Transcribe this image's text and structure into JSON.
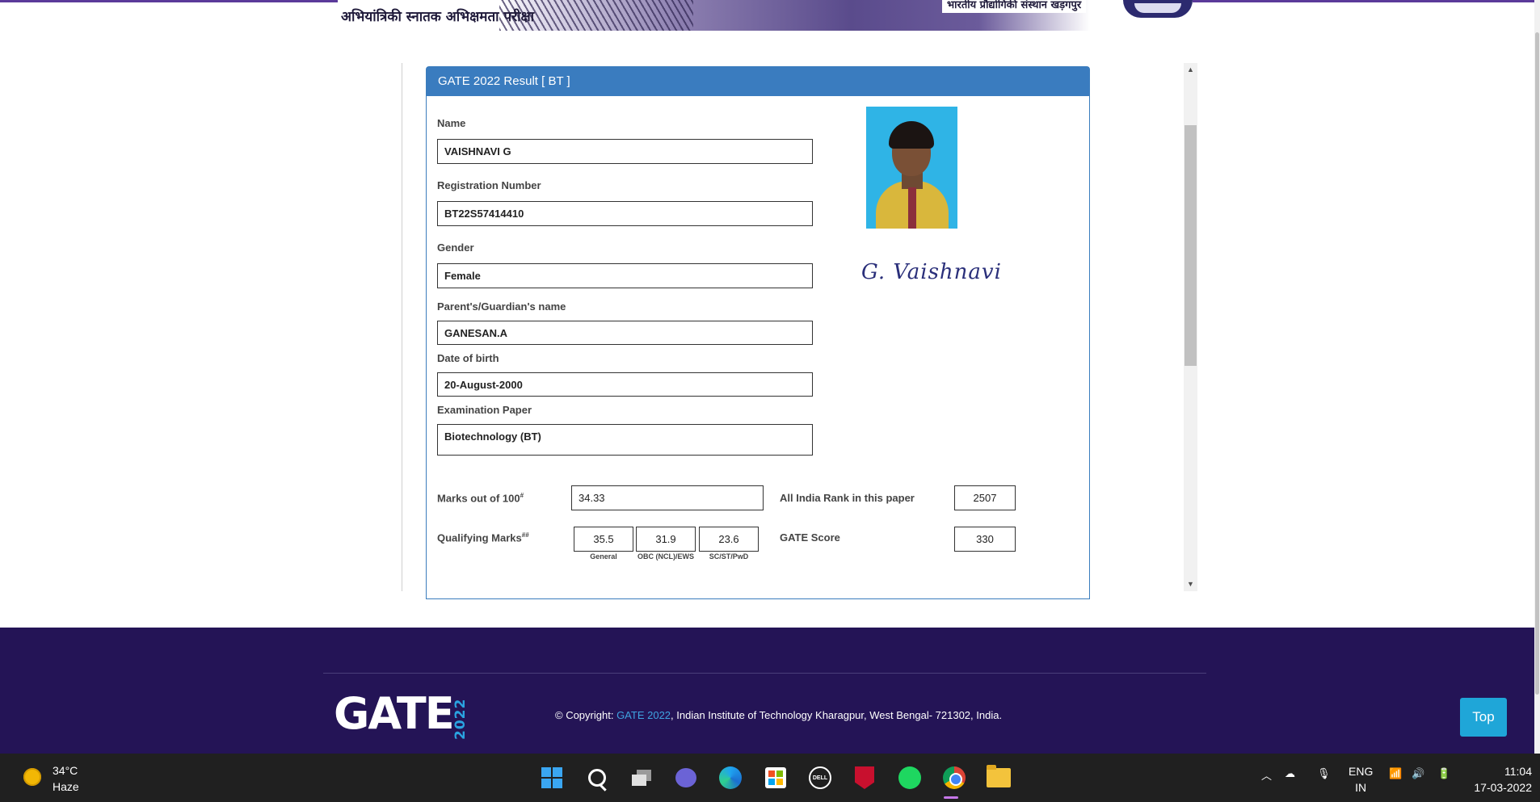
{
  "banner": {
    "hindi_left": "अभियांत्रिकी स्नातक अभिक्षमता परीक्षा",
    "hindi_right": "भारतीय प्रौद्योगिकी संस्थान खड़गपुर"
  },
  "result": {
    "title": "GATE 2022 Result [ BT ]",
    "fields": {
      "name_label": "Name",
      "name_value": "VAISHNAVI G",
      "reg_label": "Registration Number",
      "reg_value": "BT22S57414410",
      "gender_label": "Gender",
      "gender_value": "Female",
      "parent_label": "Parent's/Guardian's name",
      "parent_value": "GANESAN.A",
      "dob_label": "Date of birth",
      "dob_value": "20-August-2000",
      "paper_label": "Examination Paper",
      "paper_value": "Biotechnology (BT)"
    },
    "marks": {
      "marks_label": "Marks out of 100",
      "marks_sup": "#",
      "marks_value": "34.33",
      "rank_label": "All India Rank in this paper",
      "rank_value": "2507",
      "qual_label": "Qualifying Marks",
      "qual_sup": "##",
      "qual_general": "35.5",
      "qual_obc": "31.9",
      "qual_sc": "23.6",
      "general_caption": "General",
      "obc_caption": "OBC (NCL)/EWS",
      "sc_caption": "SC/ST/PwD",
      "score_label": "GATE Score",
      "score_value": "330"
    },
    "signature": "G. Vaishnavi"
  },
  "footer": {
    "logo": "GATE",
    "logo_year": "2022",
    "copyright_prefix": "© Copyright: ",
    "copyright_link": "GATE 2022",
    "copyright_suffix": ", Indian Institute of Technology Kharagpur, West Bengal- 721302, India.",
    "top_button": "Top"
  },
  "taskbar": {
    "weather_temp": "34°C",
    "weather_cond": "Haze",
    "dell_label": "DELL",
    "lang_top": "ENG",
    "lang_bottom": "IN",
    "time": "11:04",
    "date": "17-03-2022"
  }
}
